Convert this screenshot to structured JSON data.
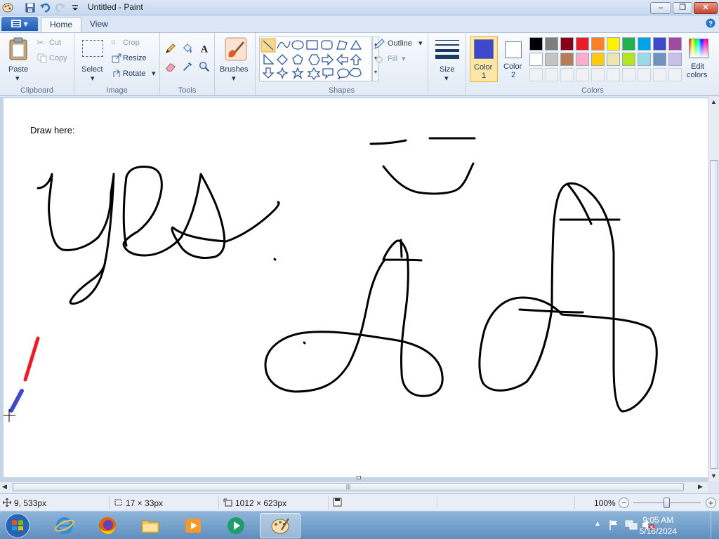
{
  "window": {
    "title": "Untitled - Paint",
    "minimize": "–",
    "maximize": "❐",
    "close": "✕"
  },
  "tabs": {
    "home": "Home",
    "view": "View"
  },
  "clipboard": {
    "group": "Clipboard",
    "paste": "Paste",
    "cut": "Cut",
    "copy": "Copy"
  },
  "image": {
    "group": "Image",
    "select": "Select",
    "crop": "Crop",
    "resize": "Resize",
    "rotate": "Rotate"
  },
  "tools": {
    "group": "Tools",
    "text_glyph": "A"
  },
  "brushes": {
    "label": "Brushes"
  },
  "shapes": {
    "group": "Shapes",
    "outline": "Outline",
    "fill": "Fill"
  },
  "size": {
    "label": "Size"
  },
  "colors": {
    "group": "Colors",
    "color1_line1": "Color",
    "color1_line2": "1",
    "color2_line1": "Color",
    "color2_line2": "2",
    "edit_line1": "Edit",
    "edit_line2": "colors",
    "color1_value": "#3f48cc",
    "color2_value": "#ffffff",
    "row1": [
      "#000000",
      "#7f7f7f",
      "#880015",
      "#ed1c24",
      "#ff7f27",
      "#fff200",
      "#22b14c",
      "#00a2e8",
      "#3f48cc",
      "#a349a4"
    ],
    "row2": [
      "#ffffff",
      "#c3c3c3",
      "#b97a57",
      "#ffaec9",
      "#ffc90e",
      "#efe4b0",
      "#b5e61d",
      "#99d9ea",
      "#7092be",
      "#c8bfe7"
    ]
  },
  "canvas": {
    "prompt": "Draw here:"
  },
  "status": {
    "cursor_pos": "9, 533px",
    "selection_size": "17 × 33px",
    "image_size": "1012 × 623px",
    "zoom": "100%",
    "zoom_minus": "−",
    "zoom_plus": "+"
  },
  "taskbar": {
    "time": "9:05 AM",
    "date": "5/16/2024"
  }
}
